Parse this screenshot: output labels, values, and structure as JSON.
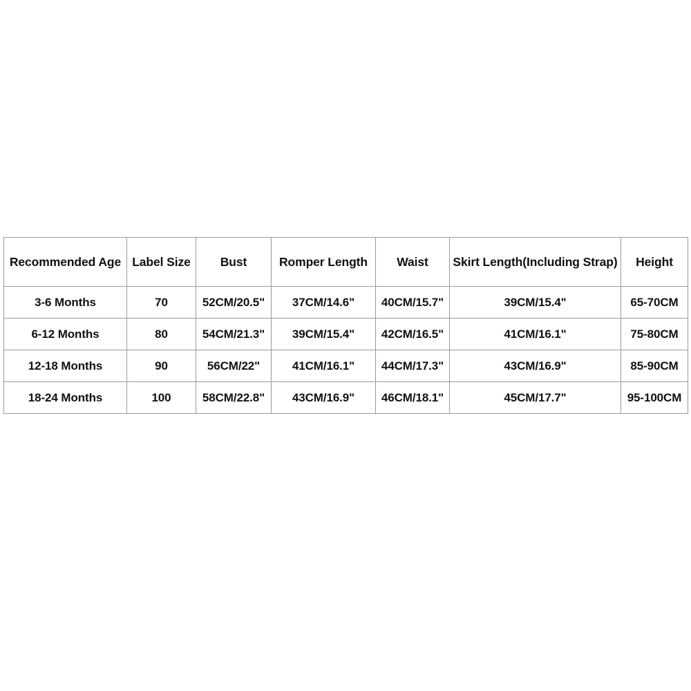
{
  "table": {
    "name": "baby-romper-size-chart",
    "headers": [
      "Recommended Age",
      "Label Size",
      "Bust",
      "Romper Length",
      "Waist",
      "Skirt Length(Including Strap)",
      "Height"
    ],
    "rows": [
      {
        "recommended_age": "3-6 Months",
        "label_size": "70",
        "bust": "52CM/20.5\"",
        "romper_length": "37CM/14.6\"",
        "waist": "40CM/15.7\"",
        "skirt_length": "39CM/15.4\"",
        "height": "65-70CM"
      },
      {
        "recommended_age": "6-12 Months",
        "label_size": "80",
        "bust": "54CM/21.3\"",
        "romper_length": "39CM/15.4\"",
        "waist": "42CM/16.5\"",
        "skirt_length": "41CM/16.1\"",
        "height": "75-80CM"
      },
      {
        "recommended_age": "12-18 Months",
        "label_size": "90",
        "bust": "56CM/22\"",
        "romper_length": "41CM/16.1\"",
        "waist": "44CM/17.3\"",
        "skirt_length": "43CM/16.9\"",
        "height": "85-90CM"
      },
      {
        "recommended_age": "18-24 Months",
        "label_size": "100",
        "bust": "58CM/22.8\"",
        "romper_length": "43CM/16.9\"",
        "waist": "46CM/18.1\"",
        "skirt_length": "45CM/17.7\"",
        "height": "95-100CM"
      }
    ]
  },
  "colors": {
    "background": "#ffffff",
    "text": "#111111",
    "border": "#9a9a9a"
  }
}
